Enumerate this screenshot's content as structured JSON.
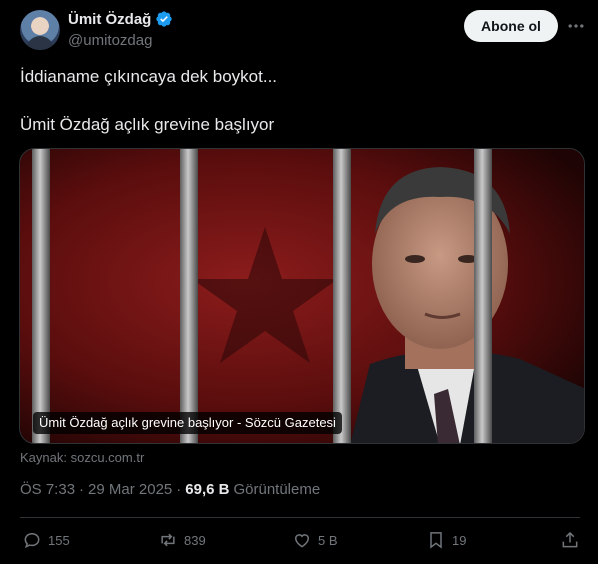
{
  "author": {
    "name": "Ümit Özdağ",
    "handle": "@umitozdag",
    "verified": true
  },
  "header": {
    "follow_label": "Abone ol"
  },
  "tweet": {
    "line1": "İddianame çıkıncaya dek boykot...",
    "line2": "Ümit Özdağ açlık grevine başlıyor"
  },
  "media_card": {
    "caption": "Ümit Özdağ açlık grevine başlıyor - Sözcü Gazetesi",
    "source": "Kaynak: sozcu.com.tr"
  },
  "meta": {
    "time": "ÖS 7:33",
    "separator": "·",
    "date": "29 Mar 2025",
    "views_count": "69,6 B",
    "views_label": "Görüntüleme"
  },
  "actions": {
    "replies": "155",
    "reposts": "839",
    "likes": "5 B",
    "bookmarks": "19"
  },
  "colors": {
    "background": "#000000",
    "text": "#e7e9ea",
    "muted": "#71767b",
    "verified": "#1d9bf0",
    "card_red": "#7a1212"
  }
}
